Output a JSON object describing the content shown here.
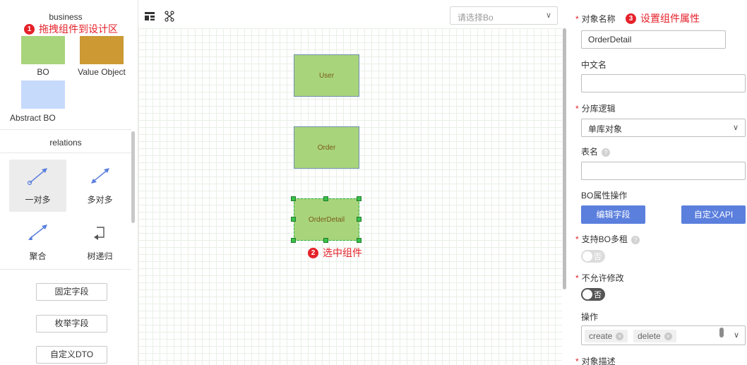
{
  "palette": {
    "business_header": "business",
    "drag_hint": {
      "number": "1",
      "text": "拖拽组件到设计区"
    },
    "shapes": [
      {
        "label": "BO",
        "color": "#a8d47b"
      },
      {
        "label": "Value Object",
        "color": "#cc9933"
      },
      {
        "label": "Abstract BO",
        "color": "#c6dafc"
      }
    ],
    "relations_header": "relations",
    "relations": [
      {
        "label": "一对多",
        "icon": "one-to-many-arrow-icon"
      },
      {
        "label": "多对多",
        "icon": "many-to-many-arrow-icon"
      },
      {
        "label": "聚合",
        "icon": "aggregation-arrow-icon"
      },
      {
        "label": "树递归",
        "icon": "tree-recursion-arrow-icon"
      }
    ],
    "field_buttons": [
      "固定字段",
      "枚举字段",
      "自定义DTO"
    ]
  },
  "canvas": {
    "bo_select_placeholder": "请选择Bo",
    "nodes": [
      {
        "label": "User"
      },
      {
        "label": "Order"
      },
      {
        "label": "OrderDetail"
      }
    ],
    "select_hint": {
      "number": "2",
      "text": "选中组件"
    }
  },
  "props": {
    "set_hint": {
      "number": "3",
      "text": "设置组件属性"
    },
    "object_name_label": "对象名称",
    "object_name_value": "OrderDetail",
    "chinese_name_label": "中文名",
    "chinese_name_value": "",
    "shard_logic_label": "分库逻辑",
    "shard_logic_value": "单库对象",
    "table_name_label": "表名",
    "table_name_value": "",
    "bo_ops_label": "BO属性操作",
    "edit_fields_btn": "编辑字段",
    "custom_api_btn": "自定义API",
    "multi_tenant_label": "支持BO多租",
    "multi_tenant_value": "否",
    "no_modify_label": "不允许修改",
    "no_modify_value": "否",
    "operations_label": "操作",
    "operations": [
      "create",
      "delete"
    ],
    "description_label": "对象描述"
  },
  "colors": {
    "accent_red": "#e5212a",
    "button_blue": "#5b7fdd",
    "bo_green": "#a8d47b",
    "selection_green": "#36c24a"
  }
}
